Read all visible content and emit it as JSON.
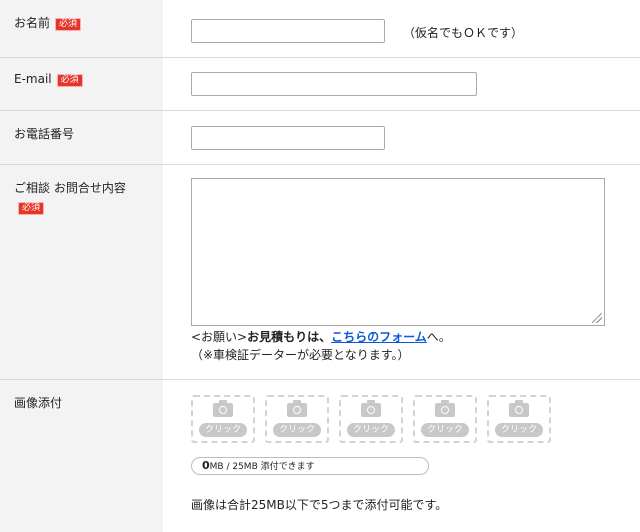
{
  "required_badge": "必須",
  "fields": {
    "name": {
      "label": "お名前",
      "hint": "（仮名でもＯＫです）"
    },
    "email": {
      "label": "E-mail"
    },
    "phone": {
      "label": "お電話番号"
    },
    "inquiry": {
      "label": "ご相談 お問合せ内容",
      "note_prefix": "<お願い>",
      "note_bold": "お見積もりは、",
      "note_link": "こちらのフォーム",
      "note_suffix": "へ。",
      "note_line2": "（※車検証データーが必要となります。）"
    },
    "images": {
      "label": "画像添付",
      "slots": [
        "クリック",
        "クリック",
        "クリック",
        "クリック",
        "クリック"
      ],
      "capacity_used": "0",
      "capacity_text": "MB / 25MB 添付できます",
      "limit_note": "画像は合計25MB以下で5つまで添付可能です。"
    }
  },
  "colors": {
    "required_badge": "#e4352b",
    "link": "#0b58d6",
    "label_bg": "#f3f3f3"
  }
}
